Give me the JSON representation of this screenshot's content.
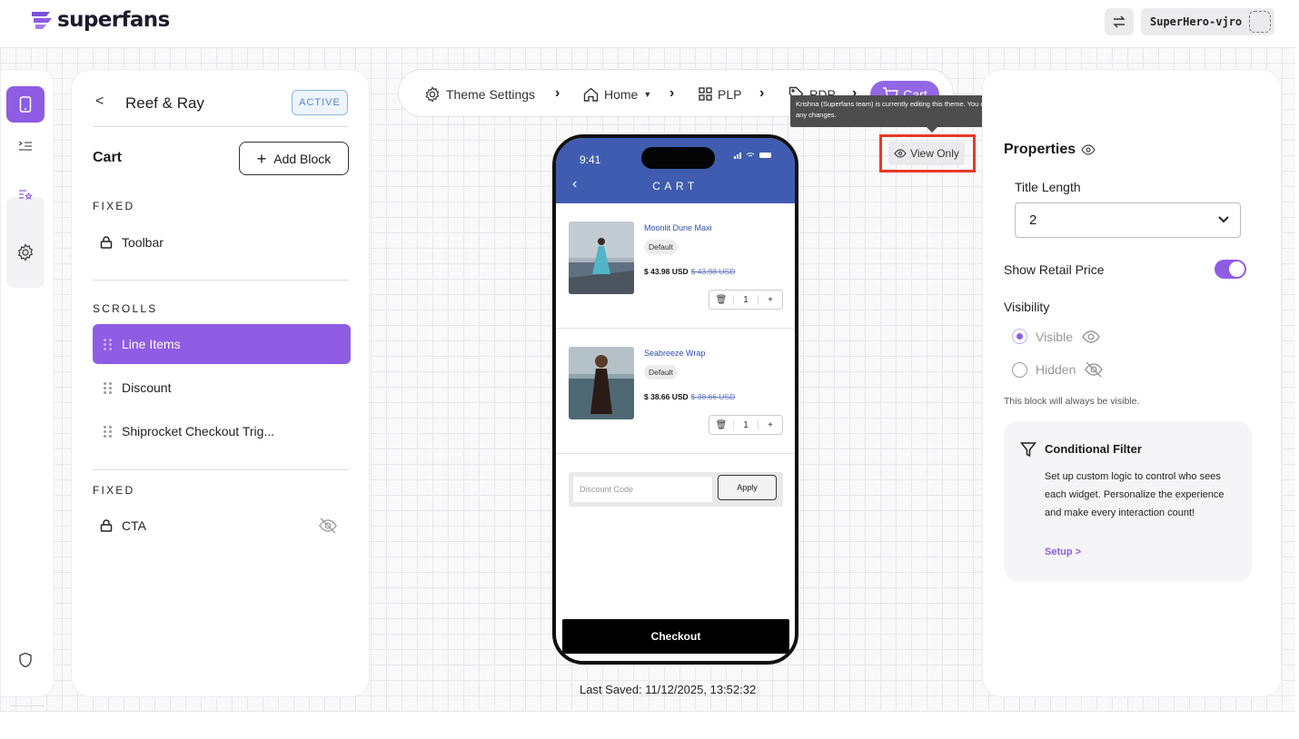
{
  "app": {
    "logo_text": "superfans",
    "user": "SuperHero-vjro"
  },
  "left_panel": {
    "back_glyph": "<",
    "store_name": "Reef & Ray",
    "status_badge": "ACTIVE",
    "section_title": "Cart",
    "add_block_label": "Add Block",
    "fixed_top_caption": "FIXED",
    "fixed_top_items": [
      "Toolbar"
    ],
    "scrolls_caption": "SCROLLS",
    "scroll_items": [
      "Line Items",
      "Discount",
      "Shiprocket Checkout Trig..."
    ],
    "fixed_bottom_caption": "FIXED",
    "fixed_bottom_items": [
      "CTA"
    ]
  },
  "breadcrumbs": {
    "theme_settings": "Theme Settings",
    "home": "Home",
    "plp": "PLP",
    "pdp": "PDP",
    "cart": "Cart"
  },
  "tooltip": "Krishna (Superfans team) is currently editing this theme. You can view it, but not make any changes.",
  "view_only_label": "View Only",
  "preview": {
    "time": "9:41",
    "title": "CART",
    "items": [
      {
        "name": "Moonlit Dune Maxi",
        "variant": "Default",
        "price": "$ 43.98 USD",
        "old_price": "$ 43.98 USD",
        "qty": "1"
      },
      {
        "name": "Seabreeze Wrap",
        "variant": "Default",
        "price": "$ 38.66 USD",
        "old_price": "$ 38.66 USD",
        "qty": "1"
      }
    ],
    "discount_placeholder": "Discount Code",
    "apply_label": "Apply",
    "checkout_label": "Checkout"
  },
  "last_saved": "Last Saved:  11/12/2025, 13:52:32",
  "properties": {
    "title": "Properties",
    "title_length_label": "Title Length",
    "title_length_value": "2",
    "show_retail_price_label": "Show Retail Price",
    "show_retail_price": true,
    "visibility_label": "Visibility",
    "visible_option": "Visible",
    "hidden_option": "Hidden",
    "visibility_note": "This block will always be visible.",
    "conditional_filter": {
      "title": "Conditional Filter",
      "description": "Set up custom logic to control who sees each widget. Personalize the experience and make every interaction count!",
      "link": "Setup >"
    }
  },
  "colors": {
    "accent": "#8f5ce4",
    "preview_header": "#3f5cb0",
    "alert": "#e83a26"
  }
}
